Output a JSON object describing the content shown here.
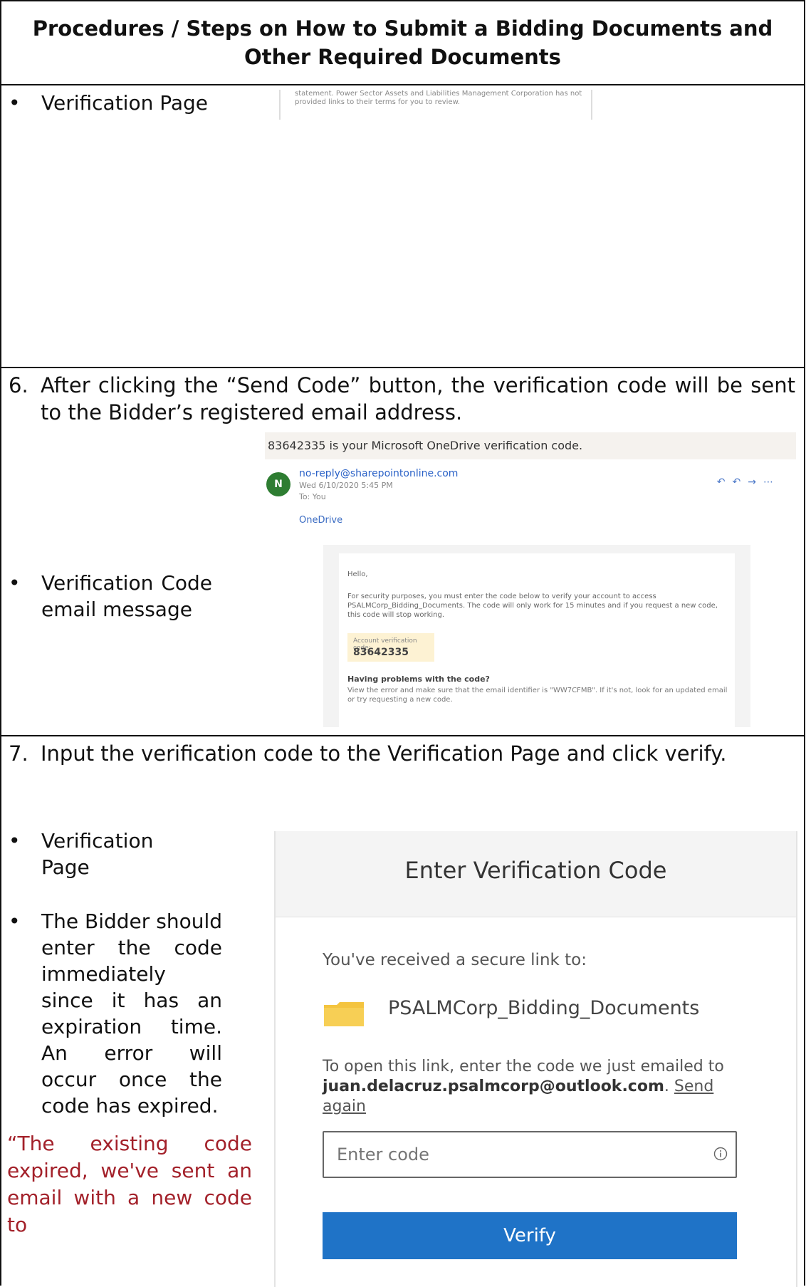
{
  "header": {
    "title": "Procedures / Steps on How to Submit a Bidding Documents and Other Required Documents"
  },
  "section1": {
    "bullet": "Verification Page",
    "snippet": "statement. Power Sector Assets and Liabilities Management Corporation has not provided links to their terms for you to review."
  },
  "step6": {
    "number": "6.",
    "text": "After clicking the “Send Code” button, the verification code will be sent to the Bidder’s registered email address.",
    "bullet": "Verification Code email message"
  },
  "email": {
    "subject": "83642335 is your Microsoft OneDrive verification code.",
    "avatar_letter": "N",
    "from": "no-reply@sharepointonline.com",
    "date": "Wed 6/10/2020 5:45 PM",
    "to": "To: You",
    "brand": "OneDrive",
    "hello": "Hello,",
    "body": "For security purposes, you must enter the code below to verify your account to access PSALMCorp_Bidding_Documents. The code will only work for 15 minutes and if you request a new code, this code will stop working.",
    "code_label": "Account verification code:",
    "code": "83642335",
    "problems_heading": "Having problems with the code?",
    "problems_text": "View the error and make sure that the email identifier is \"WW7CFMB\". If it's not, look for an updated email or try requesting a new code."
  },
  "step7": {
    "number": "7.",
    "text": "Input the verification code to the Verification Page and click verify.",
    "bullet1": "Verification Page",
    "bullet2": "The Bidder should enter the code immediately since it has an expiration time. An error will occur once the code has expired.",
    "red_note": "“The existing code expired, we've sent an email with a new code to"
  },
  "dialog": {
    "title": "Enter Verification Code",
    "received": "You've received a secure link to:",
    "file": "PSALMCorp_Bidding_Documents",
    "open_text": "To open this link, enter the code we just emailed to",
    "email": "juan.delacruz.psalmcorp@outlook.com",
    "send_again": "Send again",
    "placeholder": "Enter code",
    "verify": "Verify"
  },
  "colors": {
    "accent": "#1f73c7",
    "warning": "#a3212a",
    "folder": "#f4c43f"
  }
}
